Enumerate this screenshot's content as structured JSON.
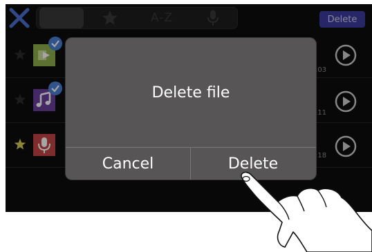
{
  "toolbar": {
    "sort_alpha_label": "A-Z",
    "delete_label": "Delete",
    "icons": [
      "close-icon",
      "clock-sort-icon",
      "star-icon",
      "microphone-icon"
    ]
  },
  "files": [
    {
      "type": "music-export",
      "starred": false,
      "checked": true,
      "time_suffix": ":03"
    },
    {
      "type": "music-note",
      "starred": false,
      "checked": true,
      "time_suffix": ":11"
    },
    {
      "type": "voice-memo",
      "starred": true,
      "checked": false,
      "time_suffix": ":18"
    }
  ],
  "dialog": {
    "title": "Delete file",
    "cancel_label": "Cancel",
    "delete_label": "Delete"
  },
  "colors": {
    "accent_blue": "#3d3d9e",
    "close_blue": "#4a6fd0",
    "star_yellow": "#d6d052",
    "dialog_bg": "#575555"
  }
}
